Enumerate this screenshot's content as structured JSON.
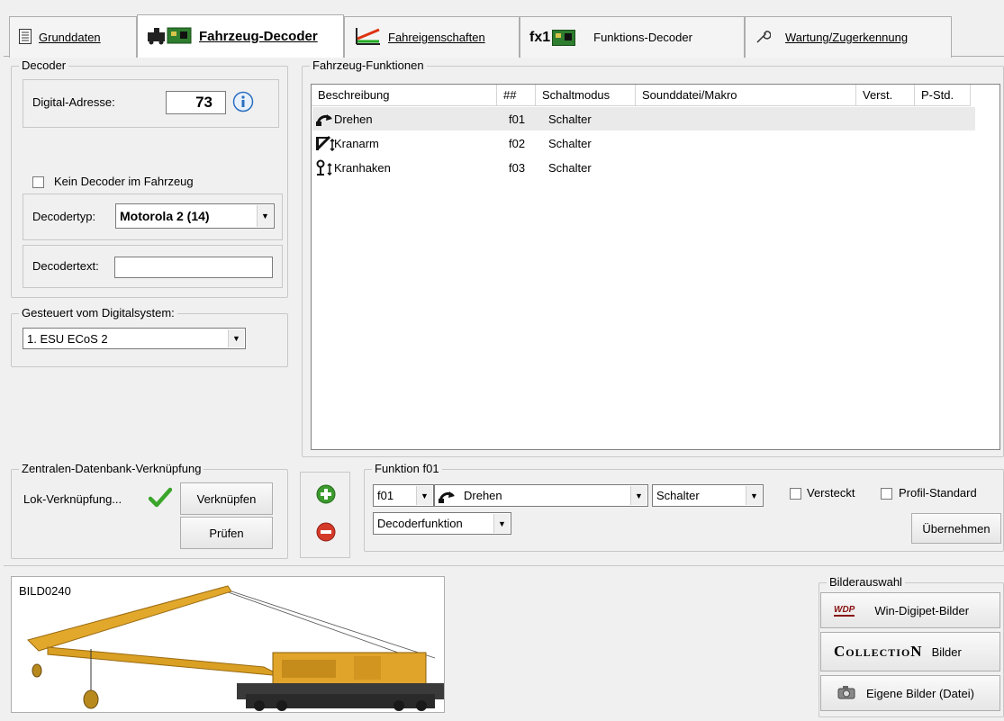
{
  "tabs": [
    {
      "label": "Grunddaten",
      "icon": "document-list-icon"
    },
    {
      "label": "Fahrzeug-Decoder",
      "icon": "locomotive-decoder-icon"
    },
    {
      "label": "Fahreigenschaften",
      "icon": "speed-curve-icon"
    },
    {
      "label": "Funktions-Decoder",
      "icon": "fx1-decoder-icon",
      "prefix": "fx1"
    },
    {
      "label": "Wartung/Zugerkennung",
      "icon": "wrench-icon"
    }
  ],
  "decoder": {
    "group_label": "Decoder",
    "address_label": "Digital-Adresse:",
    "address_value": "73",
    "no_decoder_label": "Kein Decoder im Fahrzeug",
    "no_decoder_checked": false,
    "type_label": "Decodertyp:",
    "type_value": "Motorola 2 (14)",
    "text_label": "Decodertext:",
    "text_value": ""
  },
  "digital_system": {
    "group_label": "Gesteuert vom Digitalsystem:",
    "value": "1. ESU ECoS 2"
  },
  "central_db": {
    "group_label": "Zentralen-Datenbank-Verknüpfung",
    "lok_link_label": "Lok-Verknüpfung...",
    "link_button": "Verknüpfen",
    "check_button": "Prüfen"
  },
  "functions": {
    "group_label": "Fahrzeug-Funktionen",
    "columns": [
      "Beschreibung",
      "##",
      "Schaltmodus",
      "Sounddatei/Makro",
      "Verst.",
      "P-Std."
    ],
    "rows": [
      {
        "icon": "rotate-icon",
        "name": "Drehen",
        "num": "f01",
        "mode": "Schalter",
        "sound": "",
        "verst": "",
        "pstd": "",
        "selected": true
      },
      {
        "icon": "crane-arm-icon",
        "name": "Kranarm",
        "num": "f02",
        "mode": "Schalter",
        "sound": "",
        "verst": "",
        "pstd": "",
        "selected": false
      },
      {
        "icon": "crane-hook-icon",
        "name": "Kranhaken",
        "num": "f03",
        "mode": "Schalter",
        "sound": "",
        "verst": "",
        "pstd": "",
        "selected": false
      }
    ]
  },
  "function_edit": {
    "group_label": "Funktion f01",
    "number": "f01",
    "description": "Drehen",
    "mode": "Schalter",
    "type": "Decoderfunktion",
    "hidden_label": "Versteckt",
    "profile_label": "Profil-Standard",
    "apply_button": "Übernehmen"
  },
  "image": {
    "caption": "BILD0240"
  },
  "image_select": {
    "group_label": "Bilderauswahl",
    "wdp_button": "Win-Digipet-Bilder",
    "wdp_logo": "WDP",
    "collection_logo": "CollectioN",
    "collection_button": "Bilder",
    "own_button": "Eigene Bilder (Datei)"
  },
  "colors": {
    "accent": "#d4a21a",
    "check": "#3aa52a",
    "add": "#3c9a2e",
    "remove": "#d43a2a",
    "info": "#2a6fc0"
  }
}
